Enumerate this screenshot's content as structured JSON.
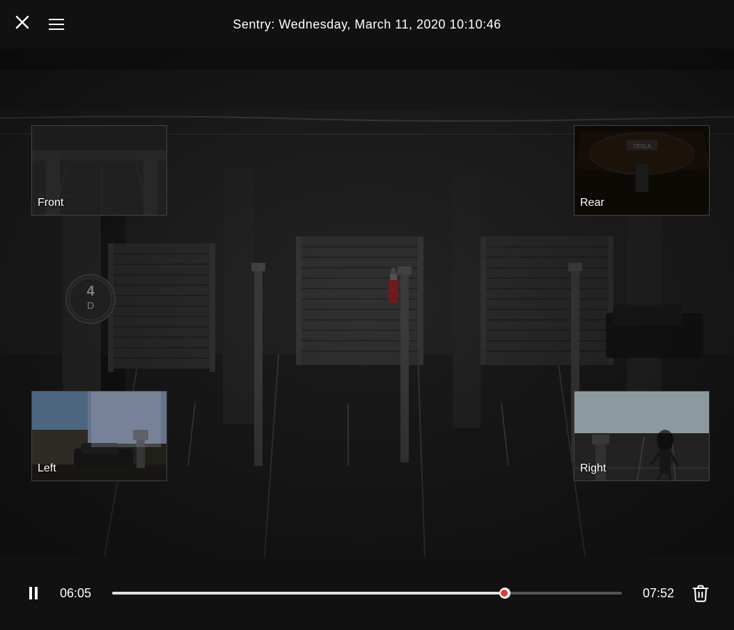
{
  "header": {
    "title": "Sentry: Wednesday, March 11, 2020 10:10:46",
    "close_label": "×",
    "menu_label": "menu"
  },
  "cameras": {
    "front": {
      "label": "Front"
    },
    "rear": {
      "label": "Rear"
    },
    "left": {
      "label": "Left"
    },
    "right": {
      "label": "Right"
    }
  },
  "controls": {
    "time_current": "06:05",
    "time_total": "07:52",
    "progress_percent": 77,
    "pause_label": "pause",
    "delete_label": "delete"
  }
}
